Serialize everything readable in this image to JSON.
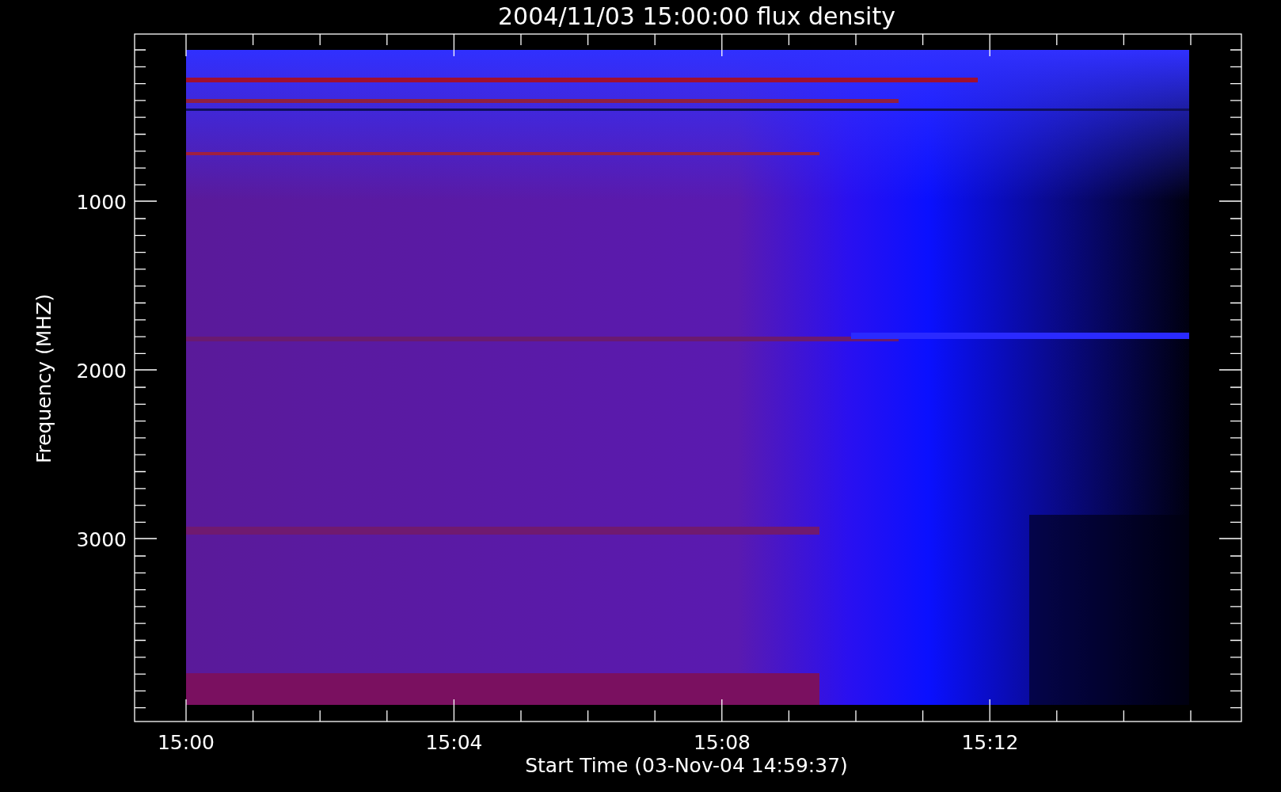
{
  "title": "2004/11/03 15:00:00 flux density",
  "y_axis": {
    "title": "Frequency (MHZ)",
    "ticks": [
      "1000",
      "2000",
      "3000"
    ]
  },
  "x_axis": {
    "title": "Start Time (03-Nov-04 14:59:37)",
    "ticks": [
      "15:00",
      "15:04",
      "15:08",
      "15:12"
    ]
  }
}
